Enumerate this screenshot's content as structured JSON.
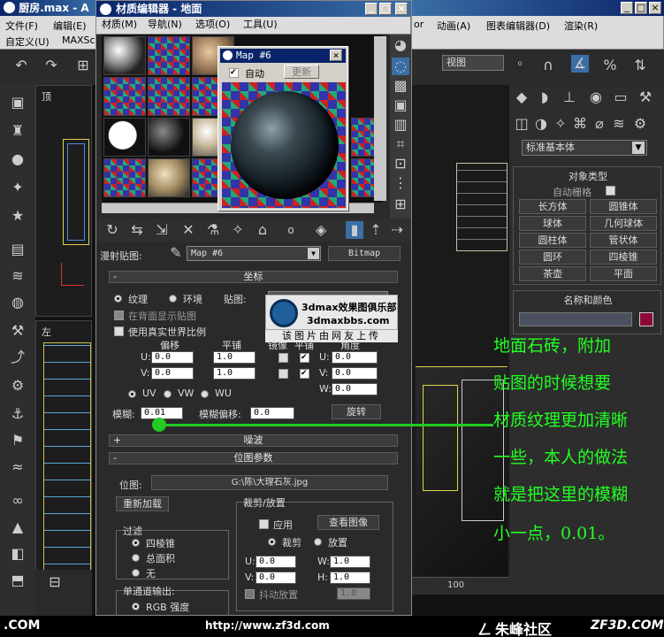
{
  "main_app": {
    "title": "厨房.max - A",
    "menu": [
      "文件(F)",
      "编辑(E)",
      "自定义(U)",
      "MAXSc"
    ],
    "viewport_top_label": "顶",
    "viewport_left_label": "左"
  },
  "right_app": {
    "menu": [
      "or",
      "动画(A)",
      "图表编辑器(D)",
      "渲染(R)"
    ],
    "view_dropdown": "视图",
    "create_dropdown": "标准基本体",
    "object_type_header": "对象类型",
    "auto_grid": "自动栅格",
    "buttons": [
      "长方体",
      "圆锥体",
      "球体",
      "几何球体",
      "圆柱体",
      "管状体",
      "圆环",
      "四棱锥",
      "茶壶",
      "平面"
    ],
    "name_color_header": "名称和颜色",
    "ruler_value": "100"
  },
  "mat_editor": {
    "title": "材质编辑器 - 地面",
    "menu": [
      "材质(M)",
      "导航(N)",
      "选项(O)",
      "工具(U)"
    ],
    "map_label": "漫射贴图:",
    "map_name": "Map #6",
    "map_type": "Bitmap",
    "preview": {
      "title": "Map #6",
      "auto": "自动",
      "update": "更新"
    },
    "coords": {
      "header": "坐标",
      "texture": "纹理",
      "environment": "环境",
      "mapping": "贴图:",
      "show_back": "在背面显示贴图",
      "real_world": "使用真实世界比例",
      "offset": "偏移",
      "tiling": "平铺",
      "mirror": "镜像",
      "tile": "平铺",
      "angle": "角度",
      "u_offset": "0.0",
      "v_offset": "0.0",
      "u_tiling": "1.0",
      "v_tiling": "1.0",
      "u_angle": "0.0",
      "v_angle": "0.0",
      "w_angle": "0.0",
      "uv": "UV",
      "vw": "VW",
      "wu": "WU",
      "blur_label": "模糊:",
      "blur": "0.01",
      "blur_offset_label": "模糊偏移:",
      "blur_offset": "0.0",
      "rotate": "旋转"
    },
    "noise_header": "噪波",
    "bitmap": {
      "header": "位图参数",
      "bitmap_label": "位图:",
      "path": "G:\\陈\\大理石灰.jpg",
      "reload": "重新加载",
      "crop_header": "裁剪/放置",
      "apply": "应用",
      "view_image": "查看图像",
      "crop": "裁剪",
      "place": "放置",
      "filter_header": "过滤",
      "pyramidal": "四棱锥",
      "summed": "总面积",
      "none": "无",
      "u": "0.0",
      "v": "0.0",
      "w": "1.0",
      "h": "1.0",
      "jitter": "抖动放置",
      "jitter_val": "1.0",
      "mono_header": "单通道输出:",
      "rgb": "RGB 强度"
    }
  },
  "watermark": {
    "logo_line1": "3dmax效果图俱乐部",
    "logo_line2": "3dmaxbbs.com",
    "caption": "该图片由网友上传"
  },
  "annotation": [
    "地面石砖，附加",
    "贴图的时候想要",
    "材质纹理更加清晰",
    "一些，本人的做法",
    "就是把这里的模糊",
    "小一点，0.01。"
  ],
  "footer": {
    "left": ".COM",
    "center": "http://www.zf3d.com",
    "right_cn": "朱峰社区",
    "right_en": "ZF3D.COM"
  },
  "colors": {
    "title_blue": "#0a246a",
    "annotation_green": "#22ff22",
    "color_swatch": "#8b0a3a"
  }
}
